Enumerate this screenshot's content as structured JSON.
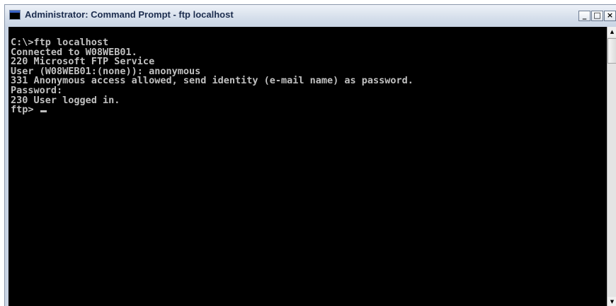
{
  "window": {
    "title": "Administrator: Command Prompt - ftp  localhost",
    "icon": "command-prompt-icon",
    "app_icon_glyph": "C:\\",
    "buttons": {
      "minimize": "_",
      "maximize": "□",
      "close": "×"
    }
  },
  "console": {
    "lines": [
      "C:\\>ftp localhost",
      "Connected to W08WEB01.",
      "220 Microsoft FTP Service",
      "User (W08WEB01:(none)): anonymous",
      "331 Anonymous access allowed, send identity (e-mail name) as password.",
      "Password:",
      "230 User logged in.",
      "ftp> "
    ]
  },
  "scrollbar": {
    "up_arrow": "▲",
    "down_arrow": "▼"
  }
}
